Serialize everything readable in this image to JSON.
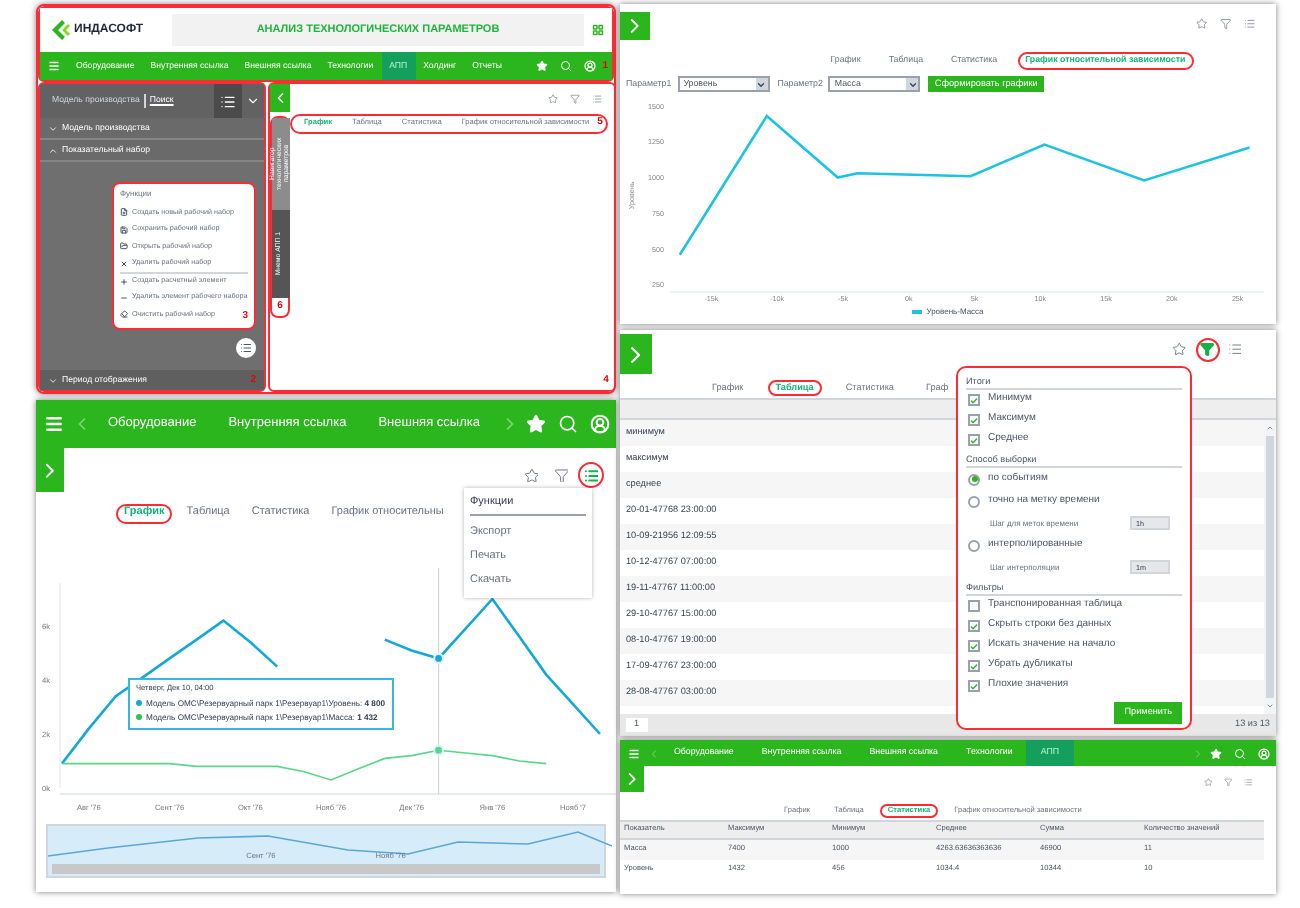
{
  "main_window": {
    "logo": "ИНДАСОФТ",
    "title": "АНАЛИЗ ТЕХНОЛОГИЧЕСКИХ ПАРАМЕТРОВ",
    "nav": {
      "items": [
        {
          "label": "Оборудование",
          "selected": false
        },
        {
          "label": "Внутренняя ссылка",
          "selected": false
        },
        {
          "label": "Внешняя ссылка",
          "selected": false
        },
        {
          "label": "Технологии",
          "selected": false
        },
        {
          "label": "АПП",
          "selected": true
        },
        {
          "label": "Холдинг",
          "selected": false
        },
        {
          "label": "Отчеты",
          "selected": false
        }
      ],
      "callout": "1"
    },
    "sidebar": {
      "search_tabs": [
        {
          "label": "Модель производства",
          "selected": false
        },
        {
          "label": "Поиск",
          "selected": true
        }
      ],
      "sections": [
        {
          "label": "Модель производства",
          "expanded": false
        },
        {
          "label": "Показательный набор",
          "expanded": true
        }
      ],
      "footer_section": {
        "label": "Период отображения",
        "expanded": false
      },
      "callout": "2",
      "functions_menu": {
        "title": "Функции",
        "callout": "3",
        "items": [
          {
            "kind": "new",
            "label": "Создать новый рабочий набор",
            "divider": false
          },
          {
            "kind": "save",
            "label": "Сохранить рабочий набор",
            "divider": false
          },
          {
            "kind": "open",
            "label": "Открыть рабочий набор",
            "divider": false
          },
          {
            "kind": "delete",
            "label": "Удалить рабочий набор",
            "divider": false
          },
          {
            "kind": "add",
            "label": "Создать расчетный элемент",
            "divider": true
          },
          {
            "kind": "remove",
            "label": "Удалить элемент рабочего набора",
            "divider": false
          },
          {
            "kind": "clear",
            "label": "Очистить рабочий набор",
            "divider": false
          }
        ]
      }
    },
    "side_tabs": {
      "items": [
        {
          "label": "Навигатор технологических параметров",
          "selected": false
        },
        {
          "label": "Мнемо АПП 1",
          "selected": true
        }
      ],
      "callout": "6"
    },
    "toolbar": [
      {
        "kind": "favorite",
        "active": false
      },
      {
        "kind": "filter",
        "active": false
      },
      {
        "kind": "menu",
        "active": false
      }
    ],
    "view_tabs": {
      "items": [
        {
          "label": "График",
          "selected": true
        },
        {
          "label": "Таблица",
          "selected": false
        },
        {
          "label": "Статистика",
          "selected": false
        },
        {
          "label": "График относительной зависимости",
          "selected": false
        }
      ],
      "callout": "5"
    },
    "content_callout": "4"
  },
  "relation_window": {
    "toolbar": [
      {
        "kind": "favorite",
        "active": false
      },
      {
        "kind": "filter",
        "active": false
      },
      {
        "kind": "menu",
        "active": false
      }
    ],
    "view_tabs": [
      {
        "label": "График",
        "selected": false
      },
      {
        "label": "Таблица",
        "selected": false
      },
      {
        "label": "Статистика",
        "selected": false
      },
      {
        "label": "График относительной зависимости",
        "selected": true
      }
    ],
    "params": [
      {
        "label": "Параметр1",
        "value": "Уровень"
      },
      {
        "label": "Параметр2",
        "value": "Масса"
      }
    ],
    "build_button": "Сформировать графики",
    "chart_data": {
      "type": "line",
      "ylabel": "Уровень",
      "x": [
        -17.4,
        -10.8,
        -5.4,
        -3.9,
        4.7,
        10.3,
        17.9,
        25.9
      ],
      "xlim": [
        -18,
        27
      ],
      "ylim": [
        200,
        1500
      ],
      "series": [
        {
          "name": "Уровень-Масса",
          "color": "#1ec3e0",
          "values": [
            460,
            1430,
            1000,
            1030,
            1010,
            1230,
            980,
            1210
          ]
        }
      ],
      "xticks": [
        {
          "value": -15,
          "label": "-15k"
        },
        {
          "value": -10,
          "label": "-10k"
        },
        {
          "value": -5,
          "label": "-5k"
        },
        {
          "value": 0,
          "label": "0k"
        },
        {
          "value": 5,
          "label": "5k"
        },
        {
          "value": 10,
          "label": "10k"
        },
        {
          "value": 15,
          "label": "15k"
        },
        {
          "value": 20,
          "label": "20k"
        },
        {
          "value": 25,
          "label": "25k"
        }
      ],
      "yticks": [
        250,
        500,
        750,
        1000,
        1250,
        1500
      ]
    }
  },
  "table_window": {
    "toolbar": [
      {
        "kind": "favorite",
        "active": false
      },
      {
        "kind": "filter",
        "active": true
      },
      {
        "kind": "menu",
        "active": false
      }
    ],
    "view_tabs": [
      {
        "label": "График",
        "selected": false
      },
      {
        "label": "Таблица",
        "selected": true
      },
      {
        "label": "Статистика",
        "selected": false
      },
      {
        "label": "Граф",
        "selected": false
      }
    ],
    "rows": [
      "минимум",
      "максимум",
      "среднее",
      "20-01-47768 23:00:00",
      "10-09-21956 12:09:55",
      "10-12-47767 07:00:00",
      "19-11-47767 11:00:00",
      "29-10-47767 15:00:00",
      "08-10-47767 19:00:00",
      "17-09-47767 23:00:00",
      "28-08-47767 03:00:00"
    ],
    "pager": {
      "page": "1",
      "count": "13 из 13"
    },
    "filter_panel": {
      "groups": [
        {
          "title": "Итоги",
          "items": [
            {
              "kind": "checkbox",
              "label": "Минимум",
              "checked": true
            },
            {
              "kind": "checkbox",
              "label": "Максимум",
              "checked": true
            },
            {
              "kind": "checkbox",
              "label": "Среднее",
              "checked": true
            }
          ]
        },
        {
          "title": "Способ выборки",
          "items": [
            {
              "kind": "radio",
              "label": "по событиям",
              "selected": true
            },
            {
              "kind": "radio",
              "label": "точно на метку времени",
              "selected": false
            },
            {
              "kind": "step",
              "label": "Шаг для меток времени",
              "value": "1h",
              "disabled": true
            },
            {
              "kind": "radio",
              "label": "интерполированные",
              "selected": false
            },
            {
              "kind": "step",
              "label": "Шаг интерполяции",
              "value": "1m",
              "disabled": true
            }
          ]
        },
        {
          "title": "Фильтры",
          "items": [
            {
              "kind": "checkbox",
              "label": "Транспонированная таблица",
              "checked": false
            },
            {
              "kind": "checkbox",
              "label": "Скрыть строки без данных",
              "checked": true
            },
            {
              "kind": "checkbox",
              "label": "Искать значение на начало",
              "checked": true
            },
            {
              "kind": "checkbox",
              "label": "Убрать дубликаты",
              "checked": true
            },
            {
              "kind": "checkbox",
              "label": "Плохие значения",
              "checked": true
            }
          ]
        }
      ],
      "apply_button": "Применить"
    }
  },
  "chart_window": {
    "nav": {
      "items": [
        {
          "label": "Оборудование",
          "selected": false
        },
        {
          "label": "Внутренняя ссылка",
          "selected": false
        },
        {
          "label": "Внешняя ссылка",
          "selected": false
        }
      ]
    },
    "toolbar": [
      {
        "kind": "favorite",
        "active": false
      },
      {
        "kind": "filter",
        "active": false
      },
      {
        "kind": "menu",
        "active": true
      }
    ],
    "view_tabs": [
      {
        "label": "График",
        "selected": true
      },
      {
        "label": "Таблица",
        "selected": false
      },
      {
        "label": "Статистика",
        "selected": false
      },
      {
        "label": "График относительны",
        "selected": false
      }
    ],
    "functions_menu": {
      "title": "Функции",
      "items": [
        "Экспорт",
        "Печать",
        "Скачать"
      ]
    },
    "chart_data": {
      "type": "line",
      "categories": [
        null,
        "Авг '76",
        null,
        null,
        "Сент '76",
        null,
        null,
        "Окт '76",
        null,
        null,
        "Нояб '76",
        null,
        null,
        "Дек '76",
        null,
        null,
        "Янв '76",
        null,
        null,
        "Нояб '7",
        null
      ],
      "ylim": [
        0,
        7.6
      ],
      "series": [
        {
          "color": "#13a9d6",
          "values": [
            0.9,
            2.2,
            3.4,
            4.1,
            4.8,
            5.5,
            6.2,
            5.4,
            4.5,
            null,
            null,
            null,
            5.5,
            5.1,
            4.8,
            5.9,
            7.0,
            5.6,
            4.2,
            3.1,
            2.0
          ]
        },
        {
          "color": "#5ad68a",
          "values": [
            0.9,
            0.9,
            0.9,
            0.9,
            0.9,
            0.8,
            0.8,
            0.8,
            0.8,
            0.6,
            0.3,
            0.7,
            1.1,
            1.2,
            1.4,
            1.3,
            1.2,
            1.0,
            0.9,
            null,
            null
          ]
        }
      ],
      "yticks": [
        {
          "value": 0,
          "label": "0k"
        },
        {
          "value": 2,
          "label": "2k"
        },
        {
          "value": 4,
          "label": "4k"
        },
        {
          "value": 6,
          "label": "6k"
        }
      ]
    },
    "tooltip": {
      "title": "Четверг, Дек 10, 04:00",
      "lines": [
        {
          "text": "Модель OMC\\Резервуарный парк 1\\Резервуар1\\Уровень: **4 800**",
          "color": "#13a9d6"
        },
        {
          "text": "Модель OMC\\Резервуарный парк 1\\Резервуар1\\Масса: **1 432**",
          "color": "#2fc25b"
        }
      ]
    },
    "navigator": {
      "labels": [
        "Сент '76",
        "Нояб '76"
      ]
    }
  },
  "stats_window": {
    "nav": {
      "items": [
        {
          "label": "Оборудование",
          "selected": false
        },
        {
          "label": "Внутренняя ссылка",
          "selected": false
        },
        {
          "label": "Внешняя ссылка",
          "selected": false
        },
        {
          "label": "Технологии",
          "selected": false
        },
        {
          "label": "АПП",
          "selected": true
        }
      ]
    },
    "toolbar": [
      {
        "kind": "favorite",
        "active": false
      },
      {
        "kind": "filter",
        "active": false
      },
      {
        "kind": "menu",
        "active": false
      }
    ],
    "view_tabs": [
      {
        "label": "График",
        "selected": false
      },
      {
        "label": "Таблица",
        "selected": false
      },
      {
        "label": "Статистика",
        "selected": true
      },
      {
        "label": "График относительной зависимости",
        "selected": false
      }
    ],
    "table": {
      "columns": [
        "Показатель",
        "Максимум",
        "Минимум",
        "Среднее",
        "Сумма",
        "Количество значений"
      ],
      "rows": [
        [
          "Масса",
          "7400",
          "1000",
          "4263.63636363636",
          "46900",
          "11"
        ],
        [
          "Уровень",
          "1432",
          "456",
          "1034.4",
          "10344",
          "10"
        ]
      ]
    }
  }
}
